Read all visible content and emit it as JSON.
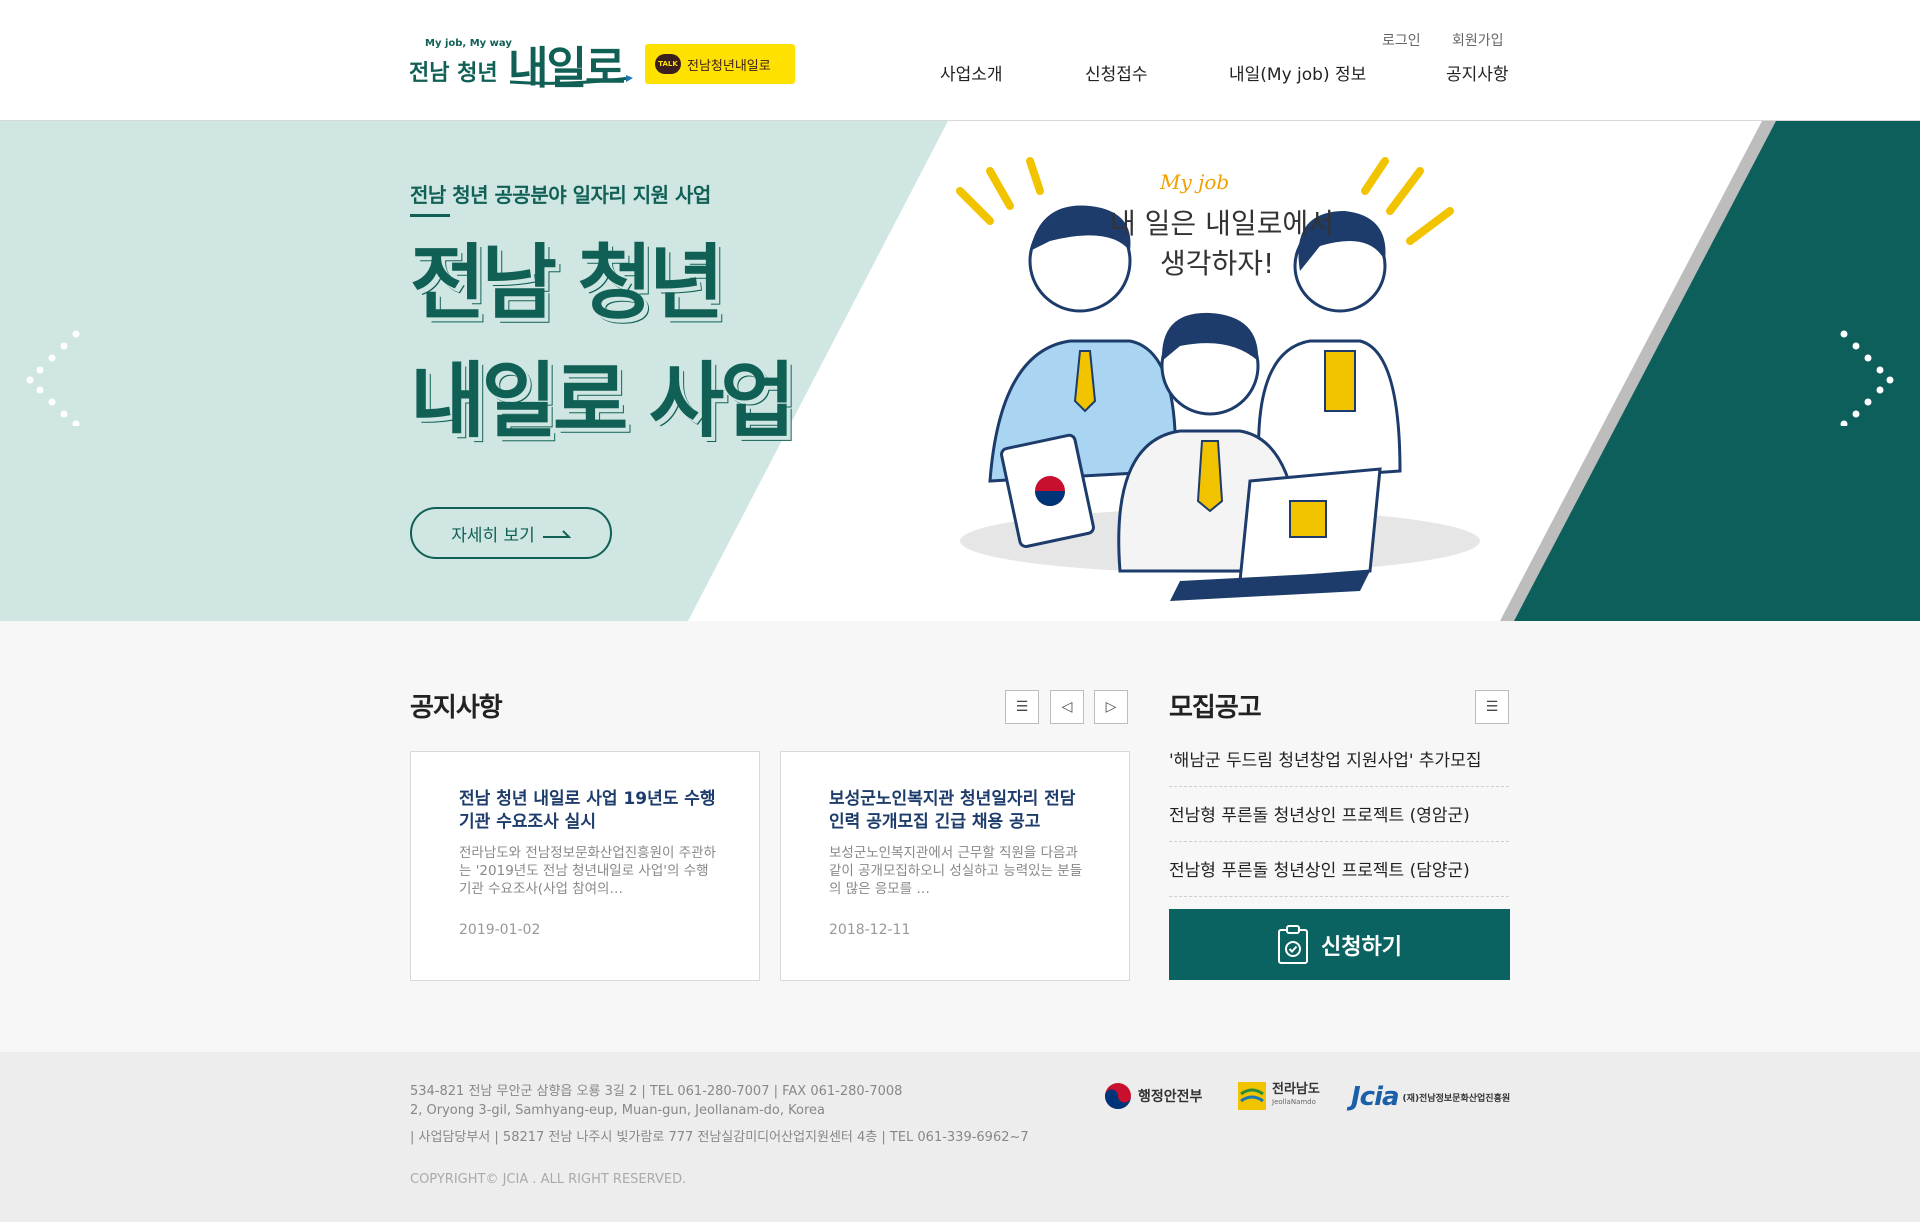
{
  "header": {
    "logo": {
      "small": "My job, My way",
      "main": "전남 청년",
      "big": "내일로"
    },
    "kakao": {
      "badge": "TALK",
      "label": "전남청년내일로"
    },
    "util": {
      "login": "로그인",
      "signup": "회원가입"
    },
    "nav": [
      {
        "label": "사업소개"
      },
      {
        "label": "신청접수"
      },
      {
        "label": "내일(My job) 정보"
      },
      {
        "label": "공지사항"
      }
    ]
  },
  "hero": {
    "subtitle": "전남 청년 공공분야 일자리 지원 사업",
    "title_line1": "전남 청년",
    "title_line2": "내일로 사업",
    "button": "자세히 보기",
    "illustration": {
      "caption_en": "My job",
      "caption_line1": "내 일은 내일로에서",
      "caption_line2": "생각하자!"
    }
  },
  "notice": {
    "title": "공지사항",
    "cards": [
      {
        "title": "전남 청년 내일로 사업 19년도 수행기관 수요조사 실시",
        "excerpt": "전라남도와 전남정보문화산업진흥원이 주관하는 '2019년도 전남 청년내일로 사업'의 수행기관 수요조사(사업 참여의…",
        "date": "2019-01-02"
      },
      {
        "title": "보성군노인복지관 청년일자리 전담인력 공개모집 긴급 채용 공고",
        "excerpt": "보성군노인복지관에서 근무할 직원을 다음과 같이 공개모집하오니 성실하고 능력있는 분들의 많은 응모를 …",
        "date": "2018-12-11"
      }
    ]
  },
  "recruit": {
    "title": "모집공고",
    "items": [
      "'해남군 두드림 청년창업 지원사업' 추가모집",
      "전남형 푸른돌 청년상인 프로젝트 (영암군)",
      "전남형 푸른돌 청년상인 프로젝트 (담양군)"
    ],
    "apply_button": "신청하기"
  },
  "footer": {
    "address1": "534-821 전남 무안군 삼향읍 오룡 3길 2  |  TEL 061-280-7007  |  FAX 061-280-7008",
    "address2": "2, Oryong 3-gil, Samhyang-eup, Muan-gun, Jeollanam-do, Korea",
    "address3": "| 사업담당부서 | 58217 전남 나주시 빛가람로 777 전남실감미디어산업지원센터 4층  |  TEL 061-339-6962~7",
    "copyright": "COPYRIGHT© JCIA . ALL RIGHT RESERVED.",
    "logos": {
      "mois": "행정안전부",
      "jeonnam": "전라남도",
      "jeonnam_en": "JeollaNamdo",
      "jcia": "Jcia",
      "jcia_full": "(재)전남정보문화산업진흥원"
    }
  },
  "colors": {
    "brand": "#116056",
    "hero_bg": "#cfe6e3",
    "kakao": "#ffe100",
    "apply": "#0b6361",
    "card_title": "#1d3c6b"
  }
}
